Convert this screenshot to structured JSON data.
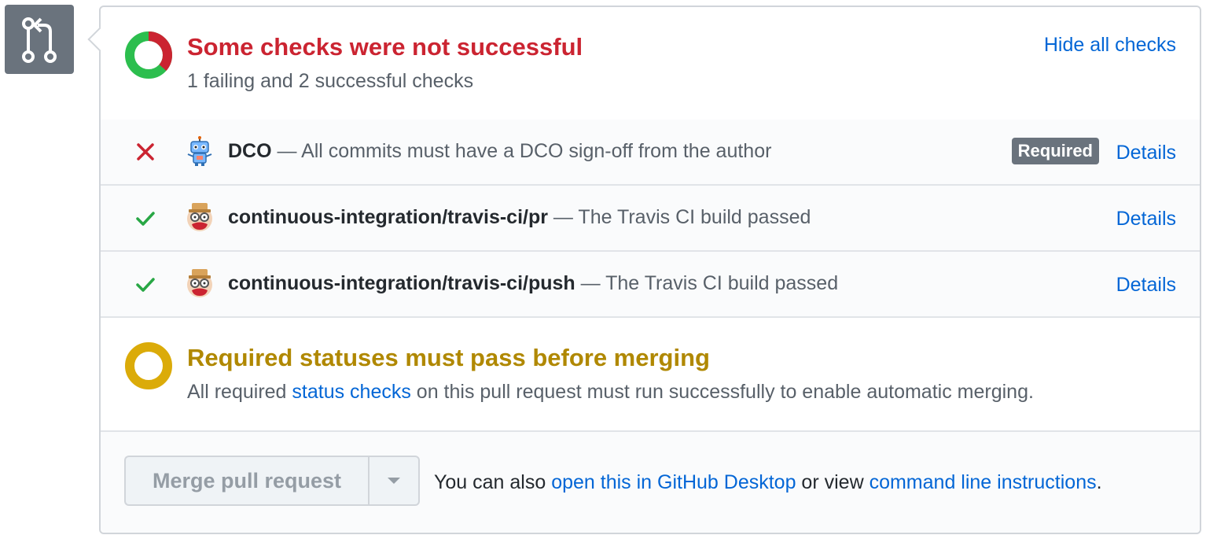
{
  "header": {
    "title": "Some checks were not successful",
    "subtitle": "1 failing and 2 successful checks",
    "hide_link": "Hide all checks",
    "colors": {
      "failure": "#cb2431",
      "success": "#2cbe4e"
    }
  },
  "checks": [
    {
      "status": "failure",
      "status_icon": "x-icon",
      "avatar_icon": "dco-robot-icon",
      "name": "DCO",
      "description": " — All commits must have a DCO sign-off from the author",
      "badge": "Required",
      "link": "Details"
    },
    {
      "status": "success",
      "status_icon": "check-icon",
      "avatar_icon": "travis-ci-icon",
      "name": "continuous-integration/travis-ci/pr",
      "description": " — The Travis CI build passed",
      "link": "Details"
    },
    {
      "status": "success",
      "status_icon": "check-icon",
      "avatar_icon": "travis-ci-icon",
      "name": "continuous-integration/travis-ci/push",
      "description": " — The Travis CI build passed",
      "link": "Details"
    }
  ],
  "required": {
    "title": "Required statuses must pass before merging",
    "text_before": "All required ",
    "link": "status checks",
    "text_after": " on this pull request must run successfully to enable automatic merging.",
    "color": "#b08800"
  },
  "merge": {
    "button_label": "Merge pull request",
    "text_before": "You can also ",
    "desktop_link": "open this in GitHub Desktop",
    "text_mid": " or view ",
    "cli_link": "command line instructions",
    "text_after": "."
  }
}
